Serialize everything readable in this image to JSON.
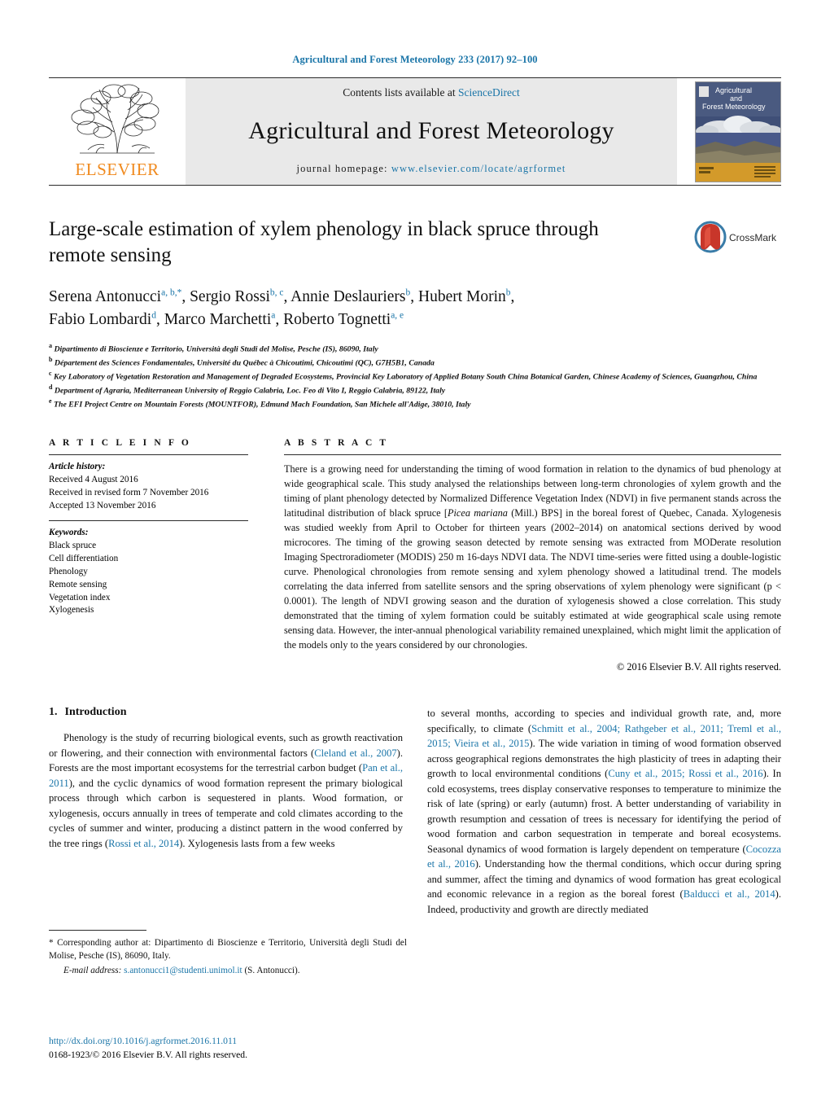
{
  "running_head": "Agricultural and Forest Meteorology 233 (2017) 92–100",
  "masthead": {
    "publisher": "ELSEVIER",
    "contents_prefix": "Contents lists available at ",
    "contents_link": "ScienceDirect",
    "journal_name": "Agricultural and Forest Meteorology",
    "homepage_prefix": "journal homepage: ",
    "homepage_url": "www.elsevier.com/locate/agrformet",
    "cover_title_line1": "Agricultural",
    "cover_title_line2": "and",
    "cover_title_line3": "Forest Meteorology"
  },
  "article": {
    "title": "Large-scale estimation of xylem phenology in black spruce through remote sensing",
    "crossmark_label": "CrossMark",
    "authors_line1": "Serena Antonucci",
    "authors": [
      {
        "name": "Serena Antonucci",
        "sup": "a, b,",
        "star": true
      },
      {
        "name": "Sergio Rossi",
        "sup": "b, c"
      },
      {
        "name": "Annie Deslauriers",
        "sup": "b"
      },
      {
        "name": "Hubert Morin",
        "sup": "b"
      },
      {
        "name": "Fabio Lombardi",
        "sup": "d"
      },
      {
        "name": "Marco Marchetti",
        "sup": "a"
      },
      {
        "name": "Roberto Tognetti",
        "sup": "a, e"
      }
    ],
    "affiliations": [
      {
        "mark": "a",
        "text": "Dipartimento di Bioscienze e Territorio, Università degli Studi del Molise, Pesche (IS), 86090, Italy"
      },
      {
        "mark": "b",
        "text": "Département des Sciences Fondamentales, Université du Québec à Chicoutimi, Chicoutimi (QC), G7H5B1, Canada"
      },
      {
        "mark": "c",
        "text": "Key Laboratory of Vegetation Restoration and Management of Degraded Ecosystems, Provincial Key Laboratory of Applied Botany South China Botanical Garden, Chinese Academy of Sciences, Guangzhou, China"
      },
      {
        "mark": "d",
        "text": "Department of Agraria, Mediterranean University of Reggio Calabria, Loc. Feo di Vito I, Reggio Calabria, 89122, Italy"
      },
      {
        "mark": "e",
        "text": "The EFI Project Centre on Mountain Forests (MOUNTFOR), Edmund Mach Foundation, San Michele all'Adige, 38010, Italy"
      }
    ]
  },
  "article_info": {
    "heading": "A R T I C L E  I N F O",
    "history_label": "Article history:",
    "history": [
      "Received 4 August 2016",
      "Received in revised form 7 November 2016",
      "Accepted 13 November 2016"
    ],
    "keywords_label": "Keywords:",
    "keywords": [
      "Black spruce",
      "Cell differentiation",
      "Phenology",
      "Remote sensing",
      "Vegetation index",
      "Xylogenesis"
    ]
  },
  "abstract": {
    "heading": "A B S T R A C T",
    "part1": "There is a growing need for understanding the timing of wood formation in relation to the dynamics of bud phenology at wide geographical scale. This study analysed the relationships between long-term chronologies of xylem growth and the timing of plant phenology detected by Normalized Difference Vegetation Index (NDVI) in five permanent stands across the latitudinal distribution of black spruce [",
    "species": "Picea mariana",
    "part2": " (Mill.) BPS] in the boreal forest of Quebec, Canada. Xylogenesis was studied weekly from April to October for thirteen years (2002–2014) on anatomical sections derived by wood microcores. The timing of the growing season detected by remote sensing was extracted from MODerate resolution Imaging Spectroradiometer (MODIS) 250 m 16-days NDVI data. The NDVI time-series were fitted using a double-logistic curve. Phenological chronologies from remote sensing and xylem phenology showed a latitudinal trend. The models correlating the data inferred from satellite sensors and the spring observations of xylem phenology were significant (p < 0.0001). The length of NDVI growing season and the duration of xylogenesis showed a close correlation. This study demonstrated that the timing of xylem formation could be suitably estimated at wide geographical scale using remote sensing data. However, the inter-annual phenological variability remained unexplained, which might limit the application of the models only to the years considered by our chronologies.",
    "copyright": "© 2016 Elsevier B.V. All rights reserved."
  },
  "introduction": {
    "number": "1.",
    "heading": "Introduction",
    "left_p1_a": "Phenology is the study of recurring biological events, such as growth reactivation or flowering, and their connection with environmental factors (",
    "left_ref1": "Cleland et al., 2007",
    "left_p1_b": "). Forests are the most important ecosystems for the terrestrial carbon budget (",
    "left_ref2": "Pan et al., 2011",
    "left_p1_c": "), and the cyclic dynamics of wood formation represent the primary biological process through which carbon is sequestered in plants. Wood formation, or xylogenesis, occurs annually in trees of temperate and cold climates according to the cycles of summer and winter, producing a distinct pattern in the wood conferred by the tree rings (",
    "left_ref3": "Rossi et al., 2014",
    "left_p1_d": "). Xylogenesis lasts from a few weeks",
    "right_a": "to several months, according to species and individual growth rate, and, more specifically, to climate (",
    "right_ref1": "Schmitt et al., 2004; Rathgeber et al., 2011; Treml et al., 2015; Vieira et al., 2015",
    "right_b": "). The wide variation in timing of wood formation observed across geographical regions demonstrates the high plasticity of trees in adapting their growth to local environmental conditions (",
    "right_ref2": "Cuny et al., 2015; Rossi et al., 2016",
    "right_c": "). In cold ecosystems, trees display conservative responses to temperature to minimize the risk of late (spring) or early (autumn) frost. A better understanding of variability in growth resumption and cessation of trees is necessary for identifying the period of wood formation and carbon sequestration in temperate and boreal ecosystems. Seasonal dynamics of wood formation is largely dependent on temperature (",
    "right_ref3": "Cocozza et al., 2016",
    "right_d": "). Understanding how the thermal conditions, which occur during spring and summer, affect the timing and dynamics of wood formation has great ecological and economic relevance in a region as the boreal forest (",
    "right_ref4": "Balducci et al., 2014",
    "right_e": "). Indeed, productivity and growth are directly mediated"
  },
  "footnote": {
    "star": "*",
    "corresponding": " Corresponding author at: Dipartimento di Bioscienze e Territorio, Università degli Studi del Molise, Pesche (IS), 86090, Italy.",
    "email_label": "E-mail address:",
    "email": "s.antonucci1@studenti.unimol.it",
    "email_owner": " (S. Antonucci)."
  },
  "doi": {
    "url": "http://dx.doi.org/10.1016/j.agrformet.2016.11.011",
    "issn_line": "0168-1923/© 2016 Elsevier B.V. All rights reserved."
  },
  "colors": {
    "link": "#1a75a8",
    "elsevier_orange": "#f08a1e",
    "band_gray": "#e9e9e9"
  }
}
